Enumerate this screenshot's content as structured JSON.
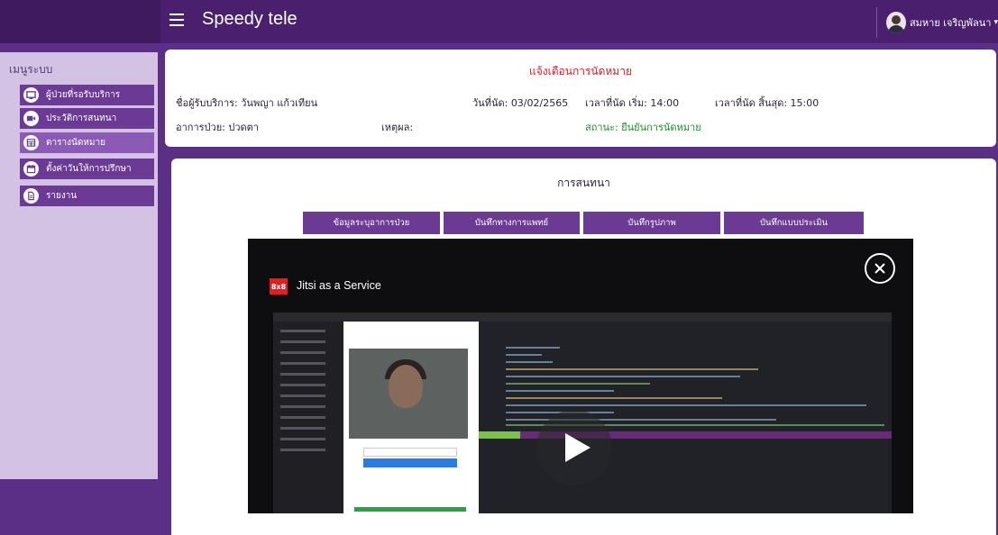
{
  "header": {
    "app_title": "Speedy tele",
    "user_name": "สมหาย เจริญพัลนา",
    "caret": "▾"
  },
  "sidebar": {
    "title": "เมนูระบบ",
    "items": [
      {
        "label": "ผู้ป่วยที่รอรับบริการ",
        "icon": "monitor-icon"
      },
      {
        "label": "ประวัติการสนทนา",
        "icon": "video-camera-icon"
      },
      {
        "label": "ตารางนัดหมาย",
        "icon": "calendar-table-icon",
        "active": true
      },
      {
        "label": "ตั้งค่าวันให้การปรึกษา",
        "icon": "calendar-icon"
      },
      {
        "label": "รายงาน",
        "icon": "document-icon"
      }
    ]
  },
  "appointment": {
    "title": "แจ้งเตือนการนัดหมาย",
    "patient": "ชื่อผู้รับบริการ: วันพญา แก้วเทียน",
    "date": "วันที่นัด: 03/02/2565",
    "start": "เวลาที่นัด เริ่ม: 14:00",
    "end": "เวลาที่นัด สิ้นสุด: 15:00",
    "symptom": "อาการป่วย: ปวดตา",
    "reason": "เหตุผล:",
    "status": "สถานะ: ยืนยันการนัดหมาย"
  },
  "chat": {
    "title": "การสนทนา",
    "tabs": [
      "ข้อมูลระบุอาการป่วย",
      "บันทึกทางการแพทย์",
      "บันทึกรูปภาพ",
      "บันทึกแบบประเมิน"
    ]
  },
  "video": {
    "logo": "8x8",
    "title": "Jitsi as a Service",
    "close_icon": "close-icon",
    "play_icon": "play-icon"
  },
  "colors": {
    "primary": "#6a3a94",
    "topbar": "#4a1f6e",
    "alert_red": "#d01f26",
    "status_green": "#1e8c2b"
  }
}
